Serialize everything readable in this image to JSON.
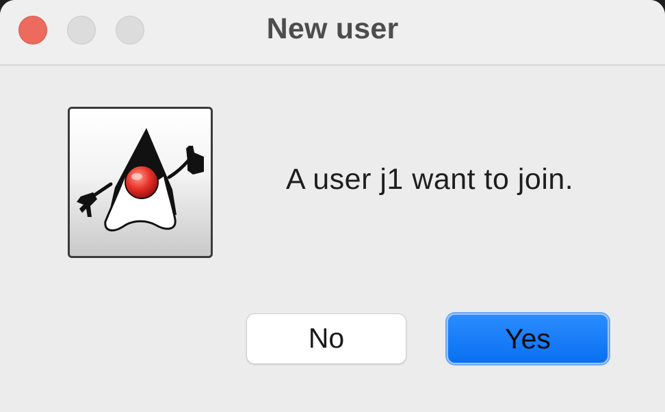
{
  "window": {
    "title": "New user"
  },
  "titlebar": {
    "buttons": [
      {
        "name": "close",
        "color": "#ed6a5e"
      },
      {
        "name": "minimize",
        "color": "#dcdcdc"
      },
      {
        "name": "zoom",
        "color": "#dcdcdc"
      }
    ]
  },
  "dialog": {
    "icon": "java-duke-icon",
    "message": "A user j1 want to join.",
    "buttons": {
      "no_label": "No",
      "yes_label": "Yes"
    }
  },
  "colors": {
    "accent": "#0a70f0",
    "background": "#ececec"
  }
}
